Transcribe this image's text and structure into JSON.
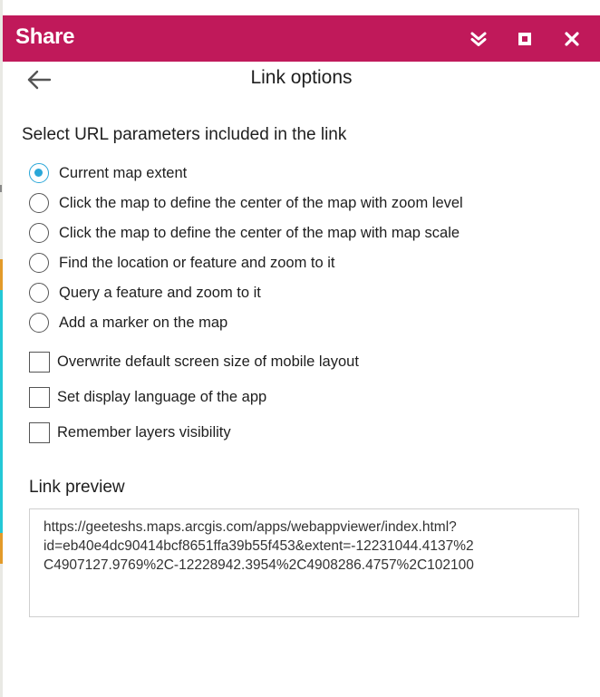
{
  "header": {
    "title": "Share",
    "background": "#c0195a",
    "icons": {
      "collapse": "double-chevron-down-icon",
      "maximize": "maximize-icon",
      "close": "close-icon"
    }
  },
  "subheader": {
    "back_icon": "arrow-left-icon",
    "title": "Link options"
  },
  "url_parameters": {
    "heading": "Select URL parameters included in the link",
    "accent": "#2aa7d8",
    "radio_options": [
      {
        "label": "Current map extent",
        "selected": true
      },
      {
        "label": "Click the map to define the center of the map with zoom level",
        "selected": false
      },
      {
        "label": "Click the map to define the center of the map with map scale",
        "selected": false
      },
      {
        "label": "Find the location or feature and zoom to it",
        "selected": false
      },
      {
        "label": "Query a feature and zoom to it",
        "selected": false
      },
      {
        "label": "Add a marker on the map",
        "selected": false
      }
    ],
    "checkbox_options": [
      {
        "label": "Overwrite default screen size of mobile layout",
        "checked": false
      },
      {
        "label": "Set display language of the app",
        "checked": false
      },
      {
        "label": "Remember layers visibility",
        "checked": false
      }
    ]
  },
  "link_preview": {
    "heading": "Link preview",
    "lines": [
      "https://geeteshs.maps.arcgis.com/apps/webappviewer/index.html?",
      "id=eb40e4dc90414bcf8651ffa39b55f453&extent=-12231044.4137%2",
      "C4907127.9769%2C-12228942.3954%2C4908286.4757%2C102100"
    ]
  }
}
